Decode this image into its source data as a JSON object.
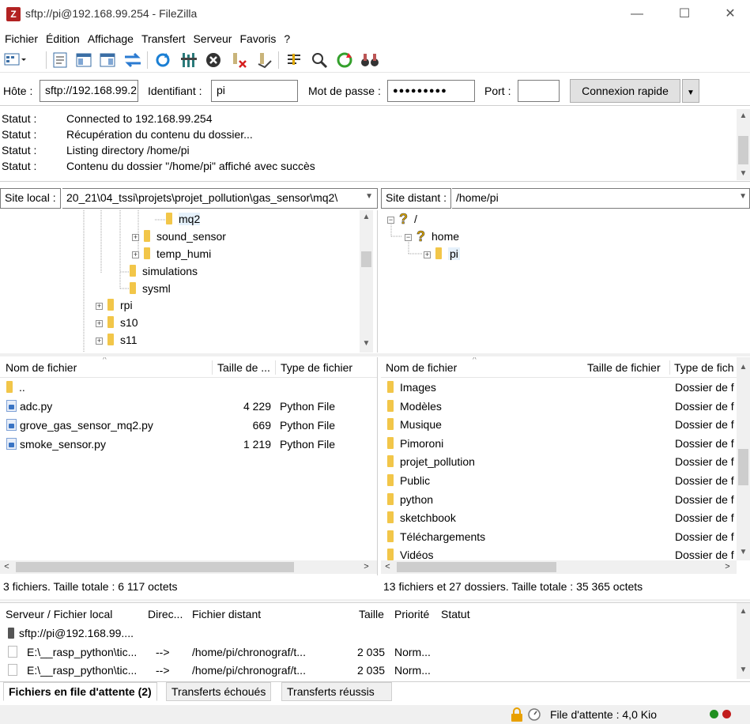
{
  "window": {
    "title": "sftp://pi@192.168.99.254 - FileZilla",
    "app_icon": "Z"
  },
  "menu": [
    "Fichier",
    "Édition",
    "Affichage",
    "Transfert",
    "Serveur",
    "Favoris",
    "?"
  ],
  "quickconnect": {
    "host_label": "Hôte :",
    "host_value": "sftp://192.168.99.2",
    "user_label": "Identifiant :",
    "user_value": "pi",
    "pass_label": "Mot de passe :",
    "pass_value": "●●●●●●●●●",
    "port_label": "Port :",
    "port_value": "",
    "connect_button": "Connexion rapide"
  },
  "log": [
    {
      "k": "Statut :",
      "v": "Connected to 192.168.99.254"
    },
    {
      "k": "Statut :",
      "v": "Récupération du contenu du dossier..."
    },
    {
      "k": "Statut :",
      "v": "Listing directory /home/pi"
    },
    {
      "k": "Statut :",
      "v": "Contenu du dossier \"/home/pi\" affiché avec succès"
    }
  ],
  "local": {
    "site_label": "Site local :",
    "site_path": "20_21\\04_tssi\\projets\\projet_pollution\\gas_sensor\\mq2\\",
    "tree": [
      "mq2",
      "sound_sensor",
      "temp_humi",
      "simulations",
      "sysml",
      "rpi",
      "s10",
      "s11"
    ],
    "headers": {
      "name": "Nom de fichier",
      "size": "Taille de ...",
      "type": "Type de fichier"
    },
    "files": [
      {
        "name": "..",
        "size": "",
        "type": ""
      },
      {
        "name": "adc.py",
        "size": "4 229",
        "type": "Python File"
      },
      {
        "name": "grove_gas_sensor_mq2.py",
        "size": "669",
        "type": "Python File"
      },
      {
        "name": "smoke_sensor.py",
        "size": "1 219",
        "type": "Python File"
      }
    ],
    "summary": "3 fichiers. Taille totale : 6 117 octets"
  },
  "remote": {
    "site_label": "Site distant :",
    "site_path": "/home/pi",
    "tree": [
      "/",
      "home",
      "pi"
    ],
    "headers": {
      "name": "Nom de fichier",
      "size": "Taille de fichier",
      "type": "Type de fich"
    },
    "files": [
      {
        "name": "Images",
        "type": "Dossier de f"
      },
      {
        "name": "Modèles",
        "type": "Dossier de f"
      },
      {
        "name": "Musique",
        "type": "Dossier de f"
      },
      {
        "name": "Pimoroni",
        "type": "Dossier de f"
      },
      {
        "name": "projet_pollution",
        "type": "Dossier de f"
      },
      {
        "name": "Public",
        "type": "Dossier de f"
      },
      {
        "name": "python",
        "type": "Dossier de f"
      },
      {
        "name": "sketchbook",
        "type": "Dossier de f"
      },
      {
        "name": "Téléchargements",
        "type": "Dossier de f"
      },
      {
        "name": "Vidéos",
        "type": "Dossier de f"
      }
    ],
    "summary": "13 fichiers et 27 dossiers. Taille totale : 35 365 octets"
  },
  "queue": {
    "headers": {
      "local": "Serveur / Fichier local",
      "dir": "Direc...",
      "remote": "Fichier distant",
      "size": "Taille",
      "priority": "Priorité",
      "status": "Statut"
    },
    "server": "sftp://pi@192.168.99....",
    "rows": [
      {
        "local": "E:\\__rasp_python\\tic...",
        "dir": "-->",
        "remote": "/home/pi/chronograf/t...",
        "size": "2 035",
        "priority": "Norm..."
      },
      {
        "local": "E:\\__rasp_python\\tic...",
        "dir": "-->",
        "remote": "/home/pi/chronograf/t...",
        "size": "2 035",
        "priority": "Norm..."
      }
    ]
  },
  "tabs": [
    "Fichiers en file d'attente (2)",
    "Transferts échoués",
    "Transferts réussis"
  ],
  "statusbar": {
    "queue": "File d'attente : 4,0 Kio"
  }
}
